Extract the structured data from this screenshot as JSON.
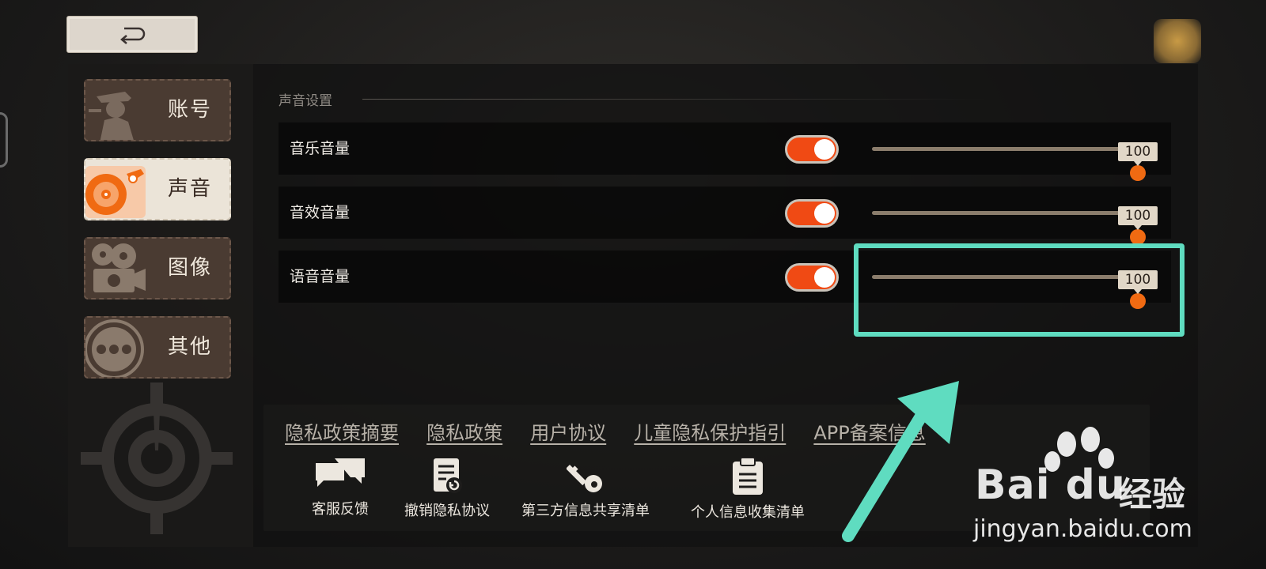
{
  "back_button": {
    "icon": "return-icon"
  },
  "sidebar": {
    "items": [
      {
        "label": "账号",
        "icon": "detective-icon",
        "active": false
      },
      {
        "label": "声音",
        "icon": "turntable-icon",
        "active": true
      },
      {
        "label": "图像",
        "icon": "film-camera-icon",
        "active": false
      },
      {
        "label": "其他",
        "icon": "more-dots-icon",
        "active": false
      }
    ]
  },
  "section": {
    "title": "声音设置"
  },
  "settings": [
    {
      "label": "音乐音量",
      "enabled": true,
      "value": "100",
      "level": 1.0
    },
    {
      "label": "音效音量",
      "enabled": true,
      "value": "100",
      "level": 1.0
    },
    {
      "label": "语音音量",
      "enabled": true,
      "value": "100",
      "level": 1.0
    }
  ],
  "footer": {
    "links": [
      "隐私政策摘要",
      "隐私政策",
      "用户协议",
      "儿童隐私保护指引",
      "APP备案信息"
    ],
    "actions": [
      {
        "label": "客服反馈",
        "icon": "chat-bubbles-icon"
      },
      {
        "label": "撤销隐私协议",
        "icon": "revoke-document-icon"
      },
      {
        "label": "第三方信息共享清单",
        "icon": "key-icon"
      },
      {
        "label": "个人信息收集清单",
        "icon": "clipboard-icon"
      }
    ]
  },
  "watermark": {
    "brand": "Bai du",
    "cn": "经验",
    "url": "jingyan.baidu.com"
  },
  "colors": {
    "accent": "#f04a14",
    "highlight": "#5fdcc0",
    "thumb": "#f06a12"
  }
}
